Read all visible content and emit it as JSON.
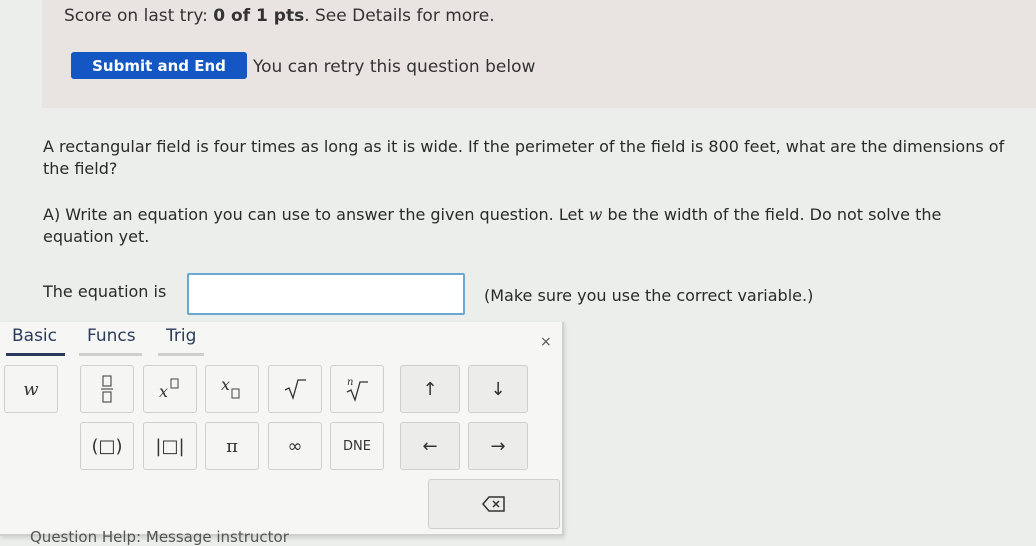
{
  "score_panel": {
    "score_prefix": "Score on last try: ",
    "score_value": "0 of 1 pts",
    "score_suffix": ". See Details for more.",
    "submit_button": "Submit and End",
    "retry_text": "You can retry this question below"
  },
  "question": {
    "text": "A rectangular field is four times as long as it is wide. If the perimeter of the field is 800 feet, what are the dimensions of the field?",
    "part_a_prefix": "A) Write an equation you can use to answer the given question. Let ",
    "part_a_var": "w",
    "part_a_suffix": " be the width of the field. Do not solve the equation yet.",
    "equation_label": "The equation is",
    "equation_value": "",
    "equation_hint": "(Make sure you use the correct variable.)"
  },
  "keypad": {
    "tabs": [
      {
        "label": "Basic",
        "active": true
      },
      {
        "label": "Funcs",
        "active": false
      },
      {
        "label": "Trig",
        "active": false
      }
    ],
    "close_label": "×",
    "row1": [
      "w",
      "□/□",
      "x□",
      "x□",
      "√",
      "ⁿ√",
      "↑",
      "↓"
    ],
    "row2": [
      "(□)",
      "|□|",
      "π",
      "∞",
      "DNE",
      "←",
      "→"
    ],
    "backspace": "⌫"
  },
  "footer": {
    "text": "Question Help:  Message instructor"
  }
}
